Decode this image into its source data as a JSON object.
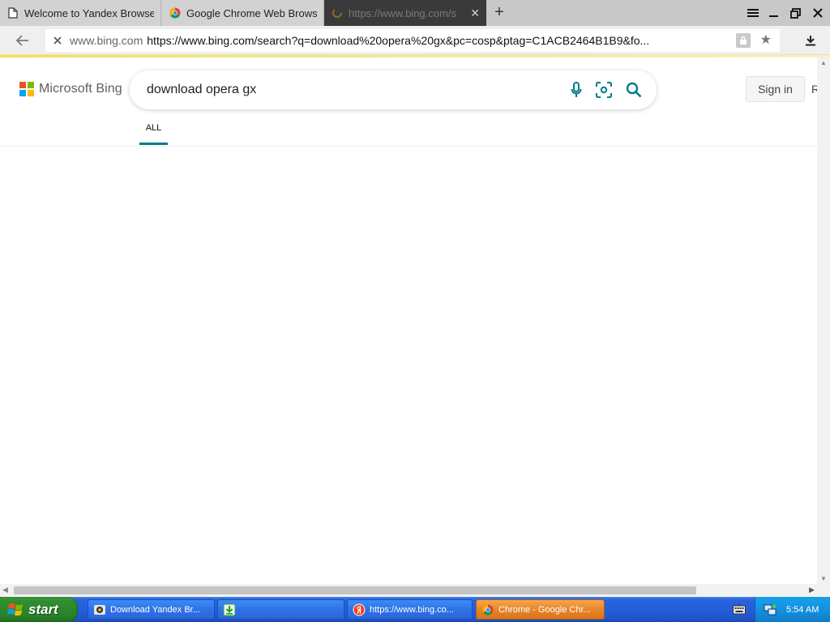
{
  "browser": {
    "tabs": [
      {
        "label": "Welcome to Yandex Browse",
        "icon": "page-icon"
      },
      {
        "label": "Google Chrome Web Browse",
        "icon": "chrome-icon"
      },
      {
        "label": "https://www.bing.com/s",
        "icon": "loading-icon",
        "active": true
      }
    ],
    "new_tab_label": "+",
    "address": {
      "host": "www.bing.com",
      "url": "https://www.bing.com/search?q=download%20opera%20gx&pc=cosp&ptag=C1ACB2464B1B9&fo..."
    }
  },
  "bing": {
    "logo_text": "Microsoft Bing",
    "search_value": "download opera gx",
    "sign_in_label": "Sign in",
    "edge_text": "R",
    "tabs": [
      {
        "label": "ALL",
        "active": true
      }
    ],
    "colors": {
      "accent": "#007c8c",
      "logo_red": "#f25022",
      "logo_green": "#7fba00",
      "logo_blue": "#00a4ef",
      "logo_yellow": "#ffb900"
    }
  },
  "taskbar": {
    "start_label": "start",
    "tasks": [
      {
        "label": "Download Yandex Br...",
        "icon": "yandex-setup-icon"
      },
      {
        "label": "",
        "icon": "download-arrow-icon"
      },
      {
        "label": "https://www.bing.co...",
        "icon": "yandex-icon"
      },
      {
        "label": "Chrome - Google Chr...",
        "icon": "chrome-icon",
        "active": true
      }
    ],
    "clock": "5:54 AM"
  }
}
